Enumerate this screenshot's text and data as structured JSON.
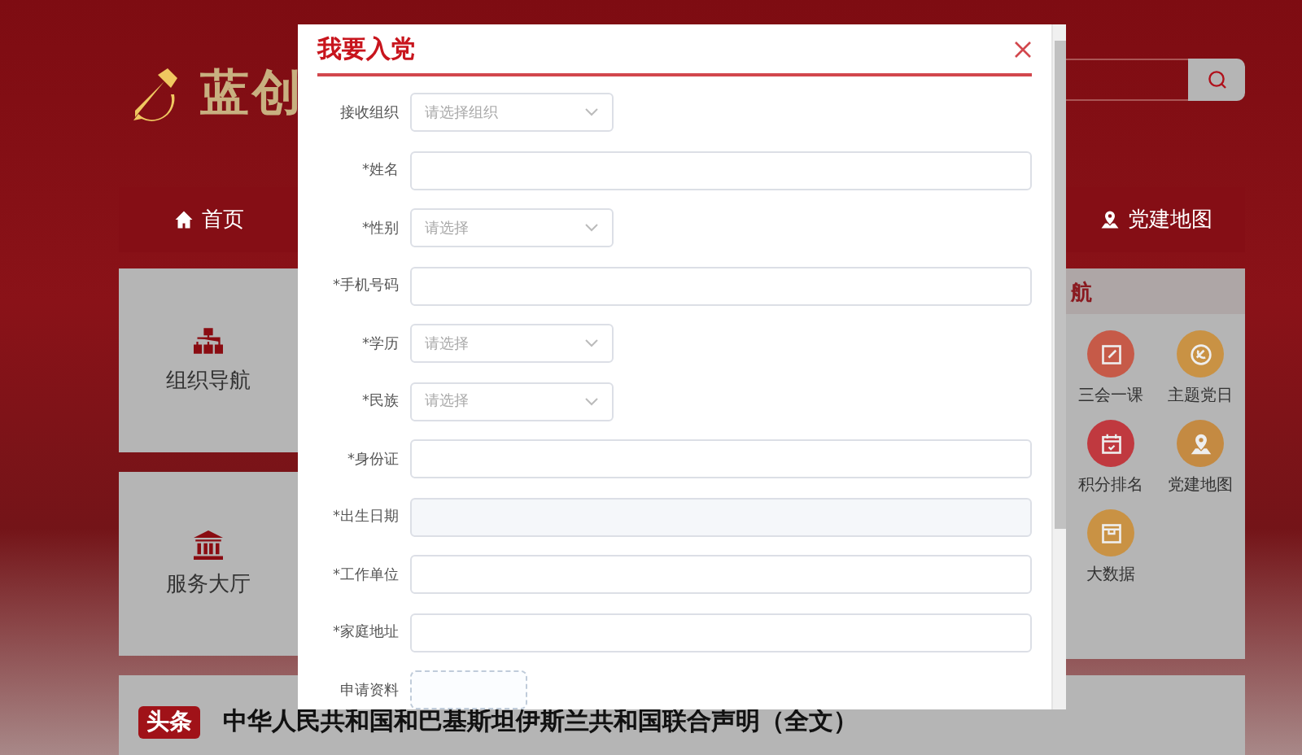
{
  "header": {
    "logo_text": "蓝创"
  },
  "nav": [
    {
      "label": "首页"
    },
    {
      "label": "党建地图"
    }
  ],
  "left_cards": [
    {
      "label": "组织导航"
    },
    {
      "label": "服务大厅"
    }
  ],
  "right_panel": {
    "title": "航",
    "items": [
      {
        "label": "三会一课",
        "color": "#c65a48"
      },
      {
        "label": "主题党日",
        "color": "#c99244"
      },
      {
        "label": "积分排名",
        "color": "#c0393f"
      },
      {
        "label": "党建地图",
        "color": "#c48a42"
      },
      {
        "label": "大数据",
        "color": "#c99244"
      }
    ]
  },
  "headline": {
    "badge": "头条",
    "text": "中华人民共和国和巴基斯坦伊斯兰共和国联合声明（全文）"
  },
  "modal": {
    "title": "我要入党",
    "fields": [
      {
        "label": "接收组织",
        "kind": "select",
        "placeholder": "请选择组织"
      },
      {
        "label": "*姓名",
        "kind": "input"
      },
      {
        "label": "*性别",
        "kind": "select",
        "placeholder": "请选择"
      },
      {
        "label": "*手机号码",
        "kind": "input"
      },
      {
        "label": "*学历",
        "kind": "select",
        "placeholder": "请选择"
      },
      {
        "label": "*民族",
        "kind": "select",
        "placeholder": "请选择"
      },
      {
        "label": "*身份证",
        "kind": "input"
      },
      {
        "label": "*出生日期",
        "kind": "date"
      },
      {
        "label": "*工作单位",
        "kind": "input"
      },
      {
        "label": "*家庭地址",
        "kind": "input"
      },
      {
        "label": "申请资料",
        "kind": "upload"
      }
    ]
  }
}
